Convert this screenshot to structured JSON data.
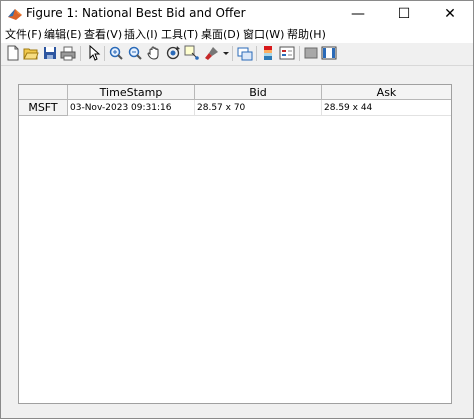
{
  "window": {
    "title": "Figure 1: National Best Bid and Offer",
    "minimize_glyph": "—",
    "maximize_glyph": "☐",
    "close_glyph": "✕"
  },
  "menu": [
    {
      "label": "文件(F)"
    },
    {
      "label": "编辑(E)"
    },
    {
      "label": "查看(V)"
    },
    {
      "label": "插入(I)"
    },
    {
      "label": "工具(T)"
    },
    {
      "label": "桌面(D)"
    },
    {
      "label": "窗口(W)"
    },
    {
      "label": "帮助(H)"
    }
  ],
  "toolbar": [
    "new-figure-icon",
    "open-file-icon",
    "save-icon",
    "print-icon",
    "pointer-icon",
    "zoom-in-icon",
    "zoom-out-icon",
    "pan-icon",
    "rotate-3d-icon",
    "data-cursor-icon",
    "brush-icon",
    "dropdown-arrow-icon",
    "link-plot-icon",
    "colorbar-icon",
    "legend-icon",
    "hide-plot-tools-icon",
    "show-plot-tools-icon"
  ],
  "table": {
    "columns": [
      "TimeStamp",
      "Bid",
      "Ask"
    ],
    "rows": [
      {
        "name": "MSFT",
        "cells": [
          "03-Nov-2023 09:31:16",
          "28.57 x 70",
          "28.59 x 44"
        ]
      }
    ]
  }
}
